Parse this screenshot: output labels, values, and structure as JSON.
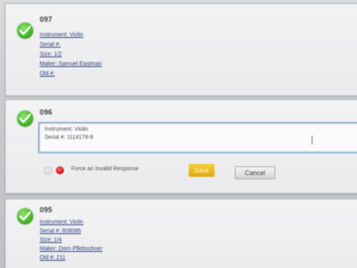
{
  "records": [
    {
      "number": "097",
      "lines": [
        "Instrument: Violin",
        "Serial #:",
        "Size: 1/2",
        "Maker: Samuel Eastman",
        "Old #:"
      ]
    },
    {
      "number": "096",
      "edit_lines": [
        "Instrument: Violin",
        "Serial #: 1114178-9"
      ],
      "force_label": "Force an Invalid Response",
      "save_label": "Save",
      "cancel_label": "Cancel"
    },
    {
      "number": "095",
      "lines": [
        "Instrument: Violin",
        "Serial #: 808086",
        "Size: 1/4",
        "Maker: Dorn Pflebschner",
        "Old #: 211"
      ]
    }
  ],
  "colors": {
    "check_green": "#47b92c",
    "invalid_red": "#d41a1a",
    "save_yellow": "#e0a90e",
    "field_focus_blue": "#8fb2cf"
  }
}
